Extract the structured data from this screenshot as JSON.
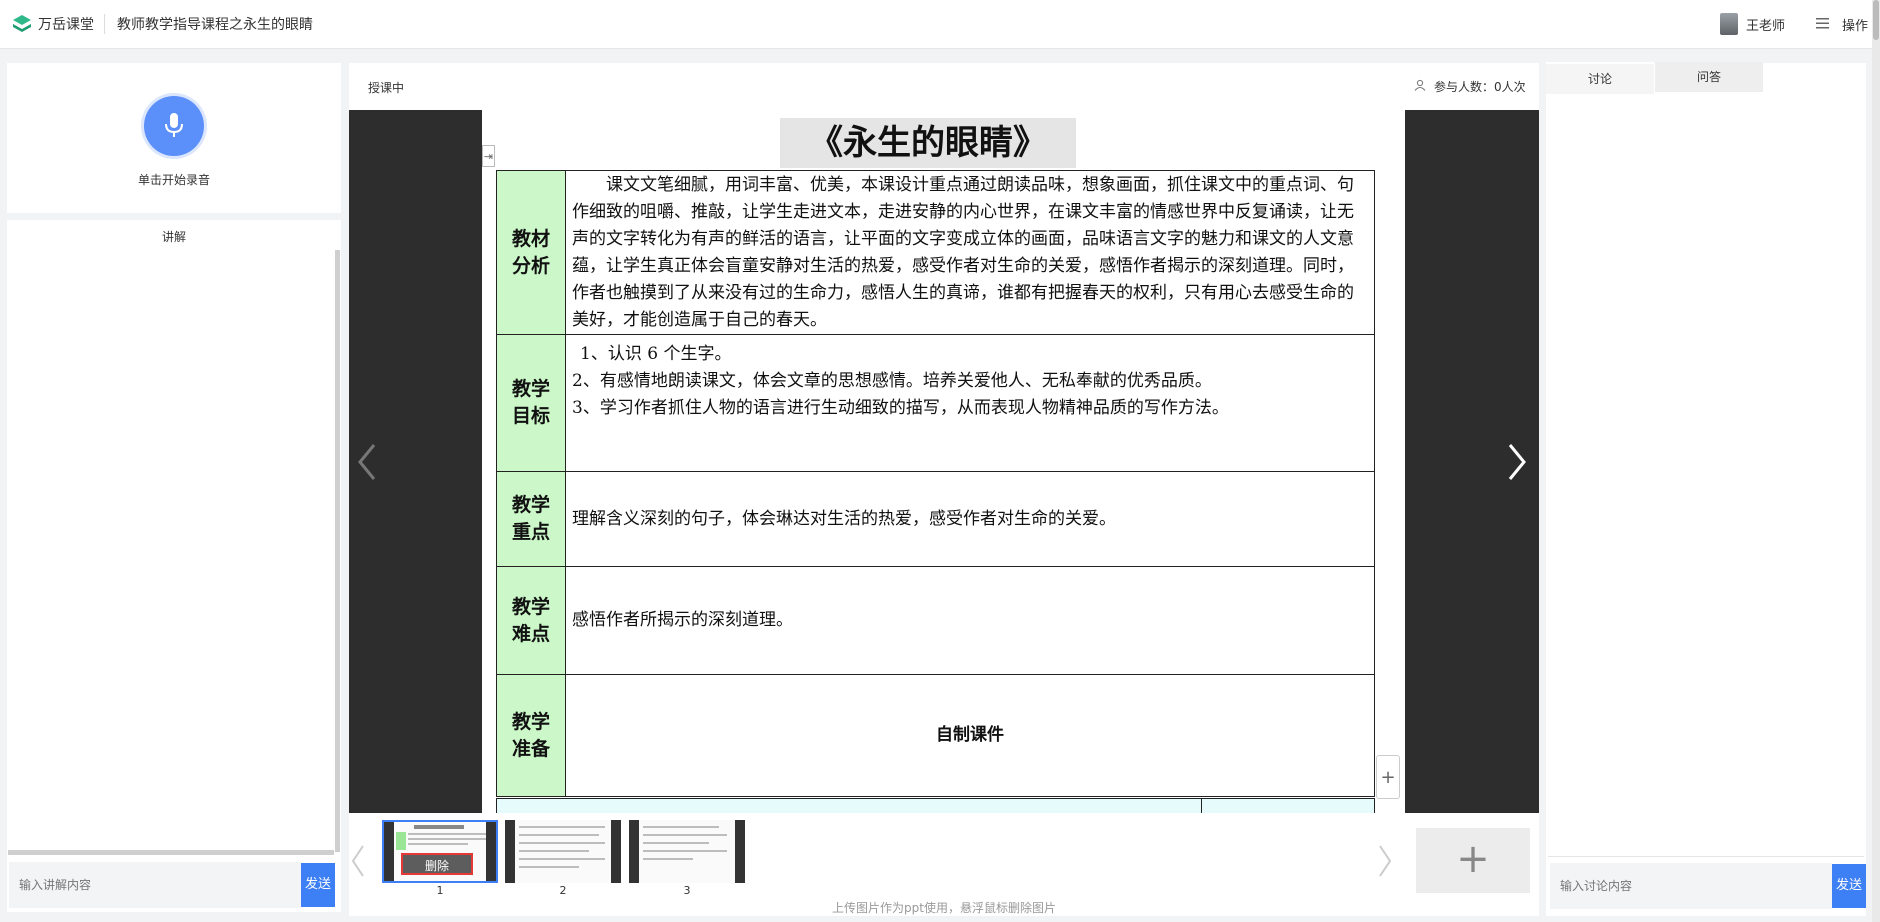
{
  "header": {
    "brand": "万岳课堂",
    "course_title": "教师教学指导课程之永生的眼睛",
    "user_name": "王老师",
    "ops_label": "操作"
  },
  "recorder": {
    "label": "单击开始录音"
  },
  "explain": {
    "title": "讲解",
    "input_placeholder": "输入讲解内容",
    "send_label": "发送"
  },
  "lesson": {
    "status": "授课中",
    "participants": "参与人数：0人次",
    "slide": {
      "title": "《永生的眼睛》",
      "rows": [
        {
          "head": "教材\n分析",
          "body": "课文文笔细腻，用词丰富、优美，本课设计重点通过朗读品味，想象画面，抓住课文中的重点词、句作细致的咀嚼、推敲，让学生走进文本，走进安静的内心世界，在课文丰富的情感世界中反复诵读，让无声的文字转化为有声的鲜活的语言，让平面的文字变成立体的画面，品味语言文字的魅力和课文的人文意蕴，让学生真正体会盲童安静对生活的热爱，感受作者对生命的关爱，感悟作者揭示的深刻道理。同时，作者也触摸到了从来没有过的生命力，感悟人生的真谛，谁都有把握春天的权利，只有用心去感受生命的美好，才能创造属于自己的春天。"
        },
        {
          "head": "教学\n目标",
          "body_lines": [
            "1、认识 6 个生字。",
            "2、有感情地朗读课文，体会文章的思想感情。培养关爱他人、无私奉献的优秀品质。",
            "3、学习作者抓住人物的语言进行生动细致的描写，从而表现人物精神品质的写作方法。"
          ]
        },
        {
          "head": "教学\n重点",
          "body": "理解含义深刻的句子，体会琳达对生活的热爱，感受作者对生命的关爱。"
        },
        {
          "head": "教学\n难点",
          "body": "感悟作者所揭示的深刻道理。"
        },
        {
          "head": "教学\n准备",
          "body": "自制课件"
        }
      ]
    },
    "thumbnails": [
      {
        "number": "1",
        "delete_label": "删除"
      },
      {
        "number": "2"
      },
      {
        "number": "3"
      }
    ],
    "add_label": "+",
    "upload_hint": "上传图片作为ppt使用，悬浮鼠标删除图片"
  },
  "discussion": {
    "tabs": [
      "讨论",
      "问答"
    ],
    "input_placeholder": "输入讨论内容",
    "send_label": "发送"
  },
  "colors": {
    "accent": "#3d7ff4",
    "mic": "#5b8ff9",
    "table_head_bg": "#ccf7c9",
    "delete_border": "#e53935"
  }
}
